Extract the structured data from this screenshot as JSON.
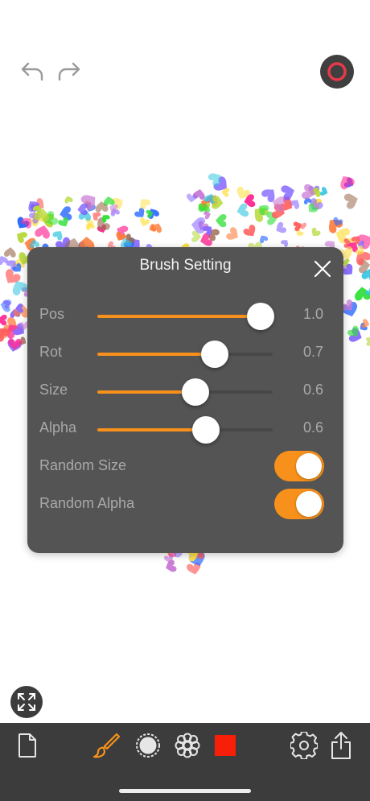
{
  "colors": {
    "accent": "#f7911b",
    "panel": "#545454",
    "toolbar": "#3c3c3c",
    "record": "#e8394a",
    "current_color": "#f81f09"
  },
  "top_bar": {
    "undo_icon": "undo-arrow-icon",
    "redo_icon": "redo-arrow-icon",
    "record_icon": "record-icon"
  },
  "panel": {
    "title": "Brush Setting",
    "close_icon": "close-icon",
    "sliders": [
      {
        "label": "Pos",
        "value": "1.0",
        "level": 0.93
      },
      {
        "label": "Rot",
        "value": "0.7",
        "level": 0.67
      },
      {
        "label": "Size",
        "value": "0.6",
        "level": 0.56
      },
      {
        "label": "Alpha",
        "value": "0.6",
        "level": 0.62
      }
    ],
    "toggles": [
      {
        "label": "Random Size",
        "on": true
      },
      {
        "label": "Random Alpha",
        "on": true
      }
    ]
  },
  "toolbar": {
    "items": [
      "new-document-icon",
      "brush-icon",
      "stamp-icon",
      "pattern-icon",
      "color-swatch-icon",
      "settings-gear-icon",
      "share-icon"
    ],
    "active": "brush-icon"
  },
  "fit_icon": "fit-screen-icon"
}
